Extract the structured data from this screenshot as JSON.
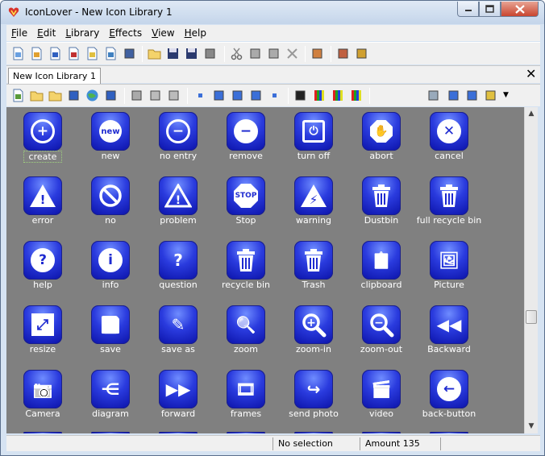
{
  "window": {
    "title": "IconLover - New Icon Library 1"
  },
  "menu": [
    "File",
    "Edit",
    "Library",
    "Effects",
    "View",
    "Help"
  ],
  "menu_underline": [
    "F",
    "E",
    "L",
    "E",
    "V",
    "H"
  ],
  "tab": {
    "label": "New Icon Library 1"
  },
  "icons": [
    {
      "label": "create",
      "glyph": "+",
      "style": "circle",
      "selected": true
    },
    {
      "label": "new",
      "glyph": "new",
      "style": "burst"
    },
    {
      "label": "no entry",
      "glyph": "−",
      "style": "circle"
    },
    {
      "label": "remove",
      "glyph": "−",
      "style": "disc"
    },
    {
      "label": "turn off",
      "glyph": "⏻",
      "style": "square"
    },
    {
      "label": "abort",
      "glyph": "✋",
      "style": "octagon"
    },
    {
      "label": "cancel",
      "glyph": "✕",
      "style": "disc"
    },
    {
      "label": "error",
      "glyph": "!",
      "style": "triangle-fill"
    },
    {
      "label": "no",
      "glyph": "⃠",
      "style": "nosign"
    },
    {
      "label": "problem",
      "glyph": "!",
      "style": "triangle"
    },
    {
      "label": "Stop",
      "glyph": "STOP",
      "style": "stop"
    },
    {
      "label": "warning",
      "glyph": "⚡",
      "style": "triangle-fill"
    },
    {
      "label": "Dustbin",
      "glyph": "🗑",
      "style": "bin"
    },
    {
      "label": "full recycle bin",
      "glyph": "🗑",
      "style": "bin"
    },
    {
      "label": "help",
      "glyph": "?",
      "style": "disc"
    },
    {
      "label": "info",
      "glyph": "i",
      "style": "disc"
    },
    {
      "label": "question",
      "glyph": "?",
      "style": "plain"
    },
    {
      "label": "recycle bin",
      "glyph": "🗑",
      "style": "bin"
    },
    {
      "label": "Trash",
      "glyph": "🗑",
      "style": "bin"
    },
    {
      "label": "clipboard",
      "glyph": "📋",
      "style": "plain"
    },
    {
      "label": "Picture",
      "glyph": "🖼",
      "style": "plain"
    },
    {
      "label": "resize",
      "glyph": "⤢",
      "style": "box"
    },
    {
      "label": "save",
      "glyph": "💾",
      "style": "plain"
    },
    {
      "label": "save as",
      "glyph": "✎",
      "style": "plain"
    },
    {
      "label": "zoom",
      "glyph": "🔍",
      "style": "plain"
    },
    {
      "label": "zoom-in",
      "glyph": "+",
      "style": "magnifier"
    },
    {
      "label": "zoom-out",
      "glyph": "−",
      "style": "magnifier"
    },
    {
      "label": "Backward",
      "glyph": "◀◀",
      "style": "plain"
    },
    {
      "label": "Camera",
      "glyph": "📷",
      "style": "plain"
    },
    {
      "label": "diagram",
      "glyph": "⋲",
      "style": "plain"
    },
    {
      "label": "forward",
      "glyph": "▶▶",
      "style": "plain"
    },
    {
      "label": "frames",
      "glyph": "🎞",
      "style": "plain"
    },
    {
      "label": "send photo",
      "glyph": "↪",
      "style": "plain"
    },
    {
      "label": "video",
      "glyph": "🎬",
      "style": "plain"
    },
    {
      "label": "back-button",
      "glyph": "←",
      "style": "disc"
    }
  ],
  "status": {
    "selection": "No selection",
    "amount": "Amount 135"
  },
  "colors": {
    "grid_bg": "#808080",
    "icon_blue": "#1e2ad0",
    "label": "#ffffff"
  }
}
